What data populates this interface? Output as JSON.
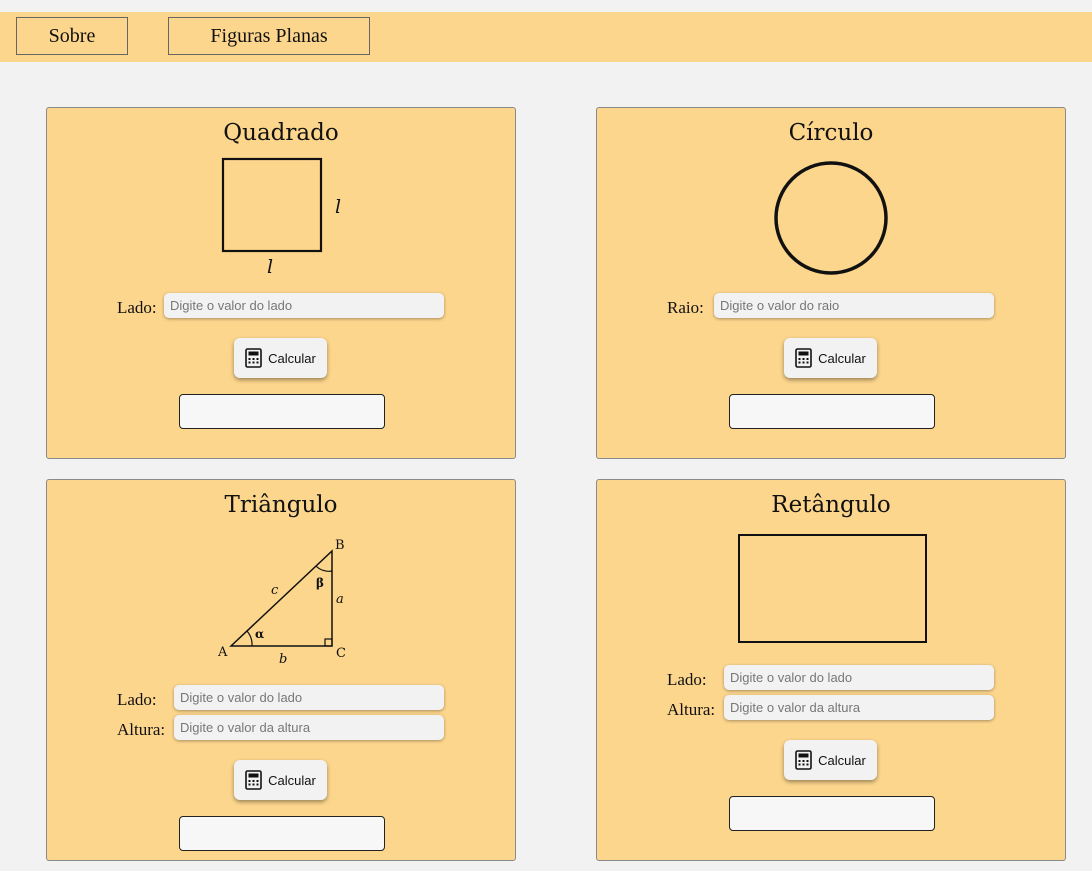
{
  "nav": {
    "about_label": "Sobre",
    "shapes_label": "Figuras Planas"
  },
  "calc_label": "Calcular",
  "square": {
    "title": "Quadrado",
    "side_mark": "l",
    "side_label": "Lado:",
    "side_placeholder": "Digite o valor do lado",
    "result": ""
  },
  "circle": {
    "title": "Círculo",
    "radius_label": "Raio:",
    "radius_placeholder": "Digite o valor do raio",
    "result": ""
  },
  "triangle": {
    "title": "Triângulo",
    "diagram": {
      "A": "A",
      "B": "B",
      "C": "C",
      "a": "a",
      "b": "b",
      "c": "c",
      "alpha": "α",
      "beta": "β"
    },
    "side_label": "Lado:",
    "side_placeholder": "Digite o valor do lado",
    "height_label": "Altura:",
    "height_placeholder": "Digite o valor da altura",
    "result": ""
  },
  "rectangle": {
    "title": "Retângulo",
    "side_label": "Lado:",
    "side_placeholder": "Digite o valor do lado",
    "height_label": "Altura:",
    "height_placeholder": "Digite o valor da altura",
    "result": ""
  },
  "colors": {
    "panel": "#fdd68d",
    "page": "#f2f2f2"
  },
  "icons": {
    "calculator": "calculator-icon"
  }
}
